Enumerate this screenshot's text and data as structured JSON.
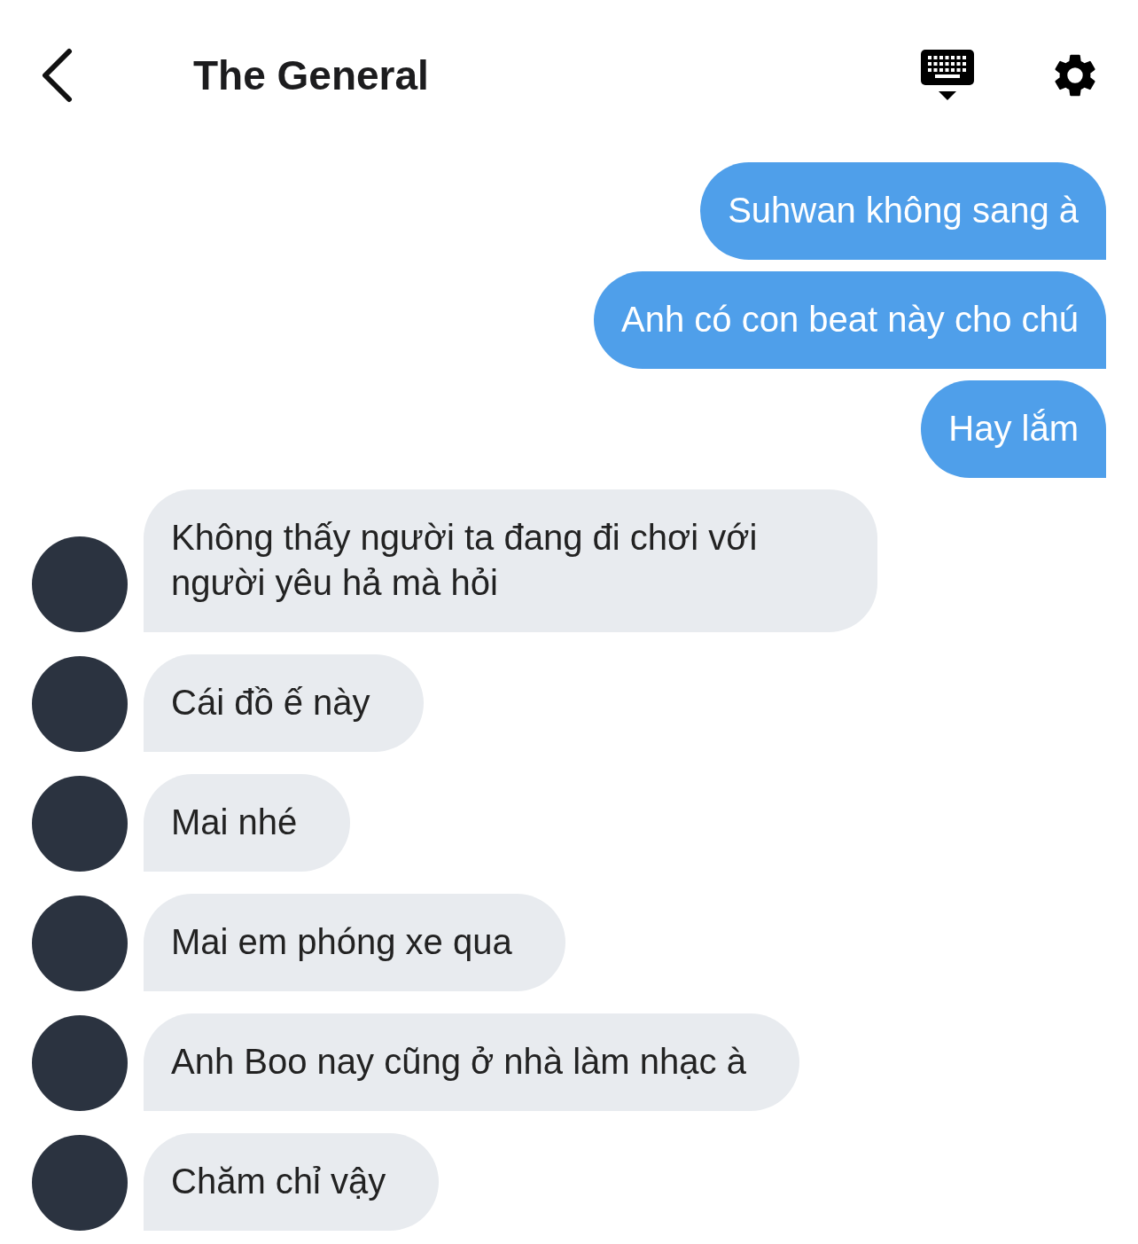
{
  "header": {
    "title": "The General"
  },
  "messages": [
    {
      "kind": "sent",
      "text": "Suhwan không sang à"
    },
    {
      "kind": "sent",
      "text": "Anh có con beat này cho chú"
    },
    {
      "kind": "sent",
      "text": "Hay lắm"
    },
    {
      "kind": "received",
      "text": "Không thấy người ta đang đi chơi với người yêu hả mà hỏi"
    },
    {
      "kind": "received",
      "text": "Cái đồ ế này"
    },
    {
      "kind": "received",
      "text": "Mai nhé"
    },
    {
      "kind": "received",
      "text": "Mai em phóng xe qua"
    },
    {
      "kind": "received",
      "text": "Anh Boo nay cũng ở nhà làm nhạc à"
    },
    {
      "kind": "received",
      "text": "Chăm chỉ vậy"
    }
  ]
}
